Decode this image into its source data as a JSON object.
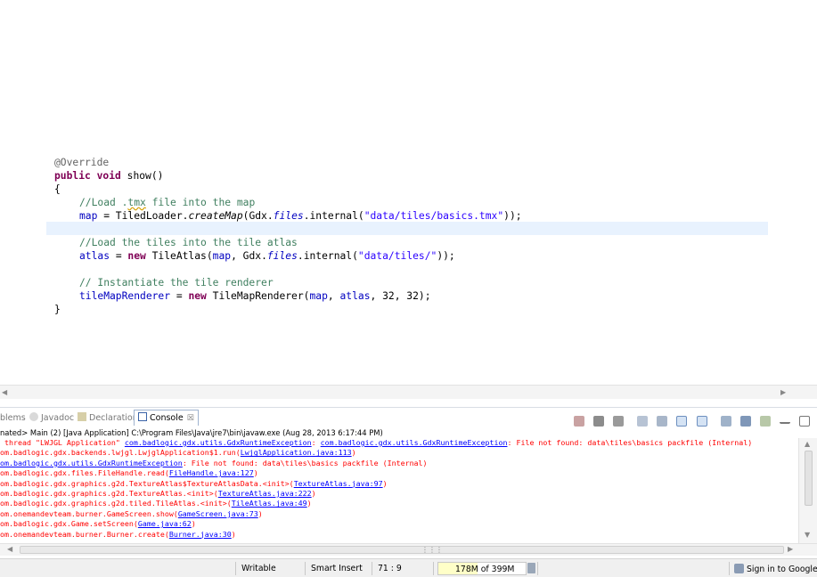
{
  "editor": {
    "annotation": "@Override",
    "sig_kw1": "public",
    "sig_kw2": "void",
    "sig_rest": " show()",
    "open_brace": "{",
    "c1_pre": "//Load .",
    "c1_squig": "tmx",
    "c1_post": " file into the map",
    "l2_field": "map",
    "l2_a": " = TiledLoader.",
    "l2_call": "createMap",
    "l2_b": "(Gdx.",
    "l2_files": "files",
    "l2_c": ".internal(",
    "l2_str": "\"data/tiles/basics.tmx\"",
    "l2_d": "));",
    "c2": "//Load the tiles into the tile atlas",
    "l4_field": "atlas",
    "l4_a": " = ",
    "l4_new": "new",
    "l4_b": " TileAtlas(",
    "l4_map": "map",
    "l4_c": ", Gdx.",
    "l4_files": "files",
    "l4_d": ".internal(",
    "l4_str": "\"data/tiles/\"",
    "l4_e": "));",
    "c3": "// Instantiate the tile renderer",
    "l6_field": "tileMapRenderer",
    "l6_a": " = ",
    "l6_new": "new",
    "l6_b": " TileMapRenderer(",
    "l6_map": "map",
    "l6_c": ", ",
    "l6_atlas": "atlas",
    "l6_d": ", 32, 32);",
    "close_brace": "}"
  },
  "tabs": {
    "problems": "blems",
    "javadoc": "Javadoc",
    "declaration": "Declaration",
    "console": "Console",
    "close": "☒"
  },
  "console": {
    "header": "nated> Main (2) [Java Application] C:\\Program Files\\Java\\jre7\\bin\\javaw.exe (Aug 28, 2013 6:17:44 PM)",
    "lines": [
      {
        "pre": " thread \"LWJGL Application\" ",
        "l1": "com.badlogic.gdx.utils.GdxRuntimeException",
        "mid": ": ",
        "l2": "com.badlogic.gdx.utils.GdxRuntimeException",
        "post": ": File not found: data\\tiles\\basics packfile (Internal)"
      },
      {
        "pre": "om.badlogic.gdx.backends.lwjgl.LwjglApplication$1.run(",
        "l1": "LwjglApplication.java:113",
        "post": ")"
      },
      {
        "pre": "",
        "l1": "om.badlogic.gdx.utils.GdxRuntimeException",
        "post": ": File not found: data\\tiles\\basics packfile (Internal)"
      },
      {
        "pre": "om.badlogic.gdx.files.FileHandle.read(",
        "l1": "FileHandle.java:127",
        "post": ")"
      },
      {
        "pre": "om.badlogic.gdx.graphics.g2d.TextureAtlas$TextureAtlasData.<init>(",
        "l1": "TextureAtlas.java:97",
        "post": ")"
      },
      {
        "pre": "om.badlogic.gdx.graphics.g2d.TextureAtlas.<init>(",
        "l1": "TextureAtlas.java:222",
        "post": ")"
      },
      {
        "pre": "om.badlogic.gdx.graphics.g2d.tiled.TileAtlas.<init>(",
        "l1": "TileAtlas.java:49",
        "post": ")"
      },
      {
        "pre": "om.onemandevteam.burner.GameScreen.show(",
        "l1": "GameScreen.java:73",
        "post": ")"
      },
      {
        "pre": "om.badlogic.gdx.Game.setScreen(",
        "l1": "Game.java:62",
        "post": ")"
      },
      {
        "pre": "om.onemandevteam.burner.Burner.create(",
        "l1": "Burner.java:30",
        "post": ")"
      }
    ]
  },
  "statusbar": {
    "writable": "Writable",
    "insert_mode": "Smart Insert",
    "position": "71 : 9",
    "heap_used": "178M",
    "heap_of": " of 399M",
    "heap_fraction": 0.446,
    "signin": "Sign in to Google..."
  },
  "colors": {
    "keyword": "#7f0055",
    "comment": "#3f7f5f",
    "string": "#2a00ff",
    "field": "#0000c0",
    "error": "#ff0000",
    "link": "#0000ff",
    "highlight": "#e8f2fe"
  }
}
